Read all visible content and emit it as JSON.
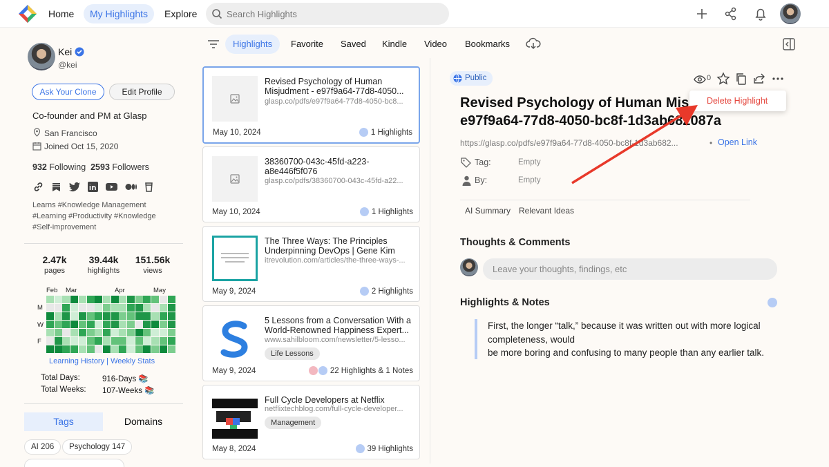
{
  "topbar": {
    "nav": [
      {
        "label": "Home"
      },
      {
        "label": "My Highlights"
      },
      {
        "label": "Explore"
      }
    ],
    "search_placeholder": "Search Highlights"
  },
  "profile": {
    "name": "Kei",
    "handle": "@kei",
    "ask_clone": "Ask Your Clone",
    "edit_profile": "Edit Profile",
    "bio": "Co-founder and PM at Glasp",
    "location": "San Francisco",
    "joined": "Joined Oct 15, 2020",
    "following_count": "932",
    "following_label": "Following",
    "followers_count": "2593",
    "followers_label": "Followers",
    "interests": [
      "Learns #Knowledge Management",
      "#Learning #Productivity #Knowledge",
      "#Self-improvement"
    ]
  },
  "stats": [
    {
      "value": "2.47k",
      "label": "pages"
    },
    {
      "value": "39.44k",
      "label": "highlights"
    },
    {
      "value": "151.56k",
      "label": "views"
    }
  ],
  "heatmap": {
    "months": [
      "Feb",
      "Mar",
      "Apr",
      "May"
    ],
    "days": [
      "M",
      "W",
      "F"
    ]
  },
  "history_links": {
    "history": "Learning History",
    "sep": "|",
    "weekly": "Weekly Stats"
  },
  "totals": {
    "days_label": "Total Days:",
    "days_value": "916-Days 📚",
    "weeks_label": "Total Weeks:",
    "weeks_value": "107-Weeks 📚"
  },
  "tag_tabs": {
    "tags": "Tags",
    "domains": "Domains"
  },
  "tags": [
    {
      "label": "AI 206"
    },
    {
      "label": "Psychology 147"
    }
  ],
  "filter_tabs": [
    {
      "label": "Highlights"
    },
    {
      "label": "Favorite"
    },
    {
      "label": "Saved"
    },
    {
      "label": "Kindle"
    },
    {
      "label": "Video"
    },
    {
      "label": "Bookmarks"
    }
  ],
  "cards": [
    {
      "title": "Revised Psychology of Human Misjudment - e97f9a64-77d8-4050...",
      "url": "glasp.co/pdfs/e97f9a64-77d8-4050-bc8...",
      "date": "May 10, 2024",
      "count": "1 Highlights"
    },
    {
      "title": "38360700-043c-45fd-a223-a8e446f5f076",
      "url": "glasp.co/pdfs/38360700-043c-45fd-a22...",
      "date": "May 10, 2024",
      "count": "1 Highlights"
    },
    {
      "title": "The Three Ways: The Principles Underpinning DevOps | Gene Kim",
      "url": "itrevolution.com/articles/the-three-ways-...",
      "date": "May 9, 2024",
      "count": "2 Highlights"
    },
    {
      "title": "5 Lessons from a Conversation With a World-Renowned Happiness Expert...",
      "url": "www.sahilbloom.com/newsletter/5-lesso...",
      "tag": "Life Lessons",
      "date": "May 9, 2024",
      "count": "22 Highlights & 1 Notes"
    },
    {
      "title": "Full Cycle Developers at Netflix",
      "url": "netflixtechblog.com/full-cycle-developer...",
      "tag": "Management",
      "date": "May 8, 2024",
      "count": "39 Highlights"
    }
  ],
  "detail": {
    "visibility": "Public",
    "views": "0",
    "menu_delete": "Delete Highlight",
    "title_line1": "Revised Psychology of Human Mis",
    "title_line2": "e97f9a64-77d8-4050-bc8f-1d3ab682087a",
    "url": "https://glasp.co/pdfs/e97f9a64-77d8-4050-bc8f-1d3ab682...",
    "bullet": "•",
    "open_link": "Open Link",
    "tag_label": "Tag:",
    "tag_value": "Empty",
    "by_label": "By:",
    "by_value": "Empty",
    "ai_summary": "AI Summary",
    "relevant": "Relevant Ideas",
    "thoughts_heading": "Thoughts & Comments",
    "comment_placeholder": "Leave your thoughts, findings, etc",
    "highlights_heading": "Highlights & Notes",
    "highlight_text": "First, the longer “talk,” because it was written out with more logical completeness, would\nbe more boring and confusing to many people than any earlier talk."
  },
  "colors": {
    "accent": "#3b74e6",
    "danger": "#e5483f",
    "arrow": "#e8392a"
  }
}
